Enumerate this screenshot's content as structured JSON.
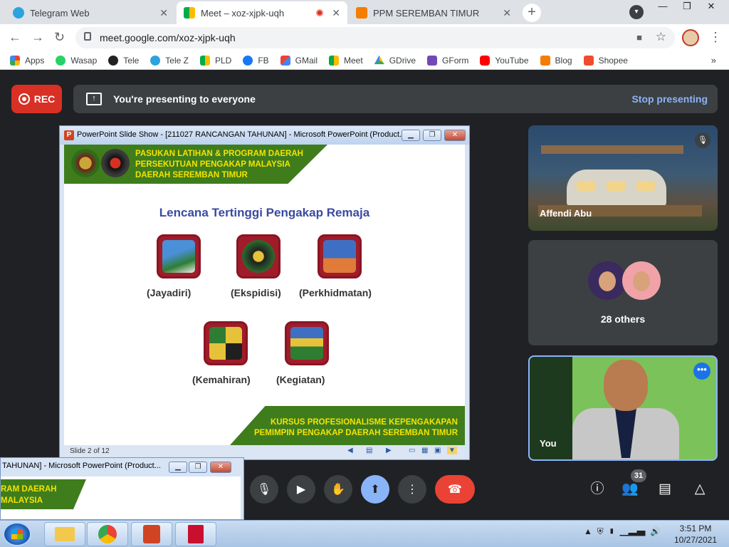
{
  "browser": {
    "tabs": [
      {
        "label": "Telegram Web",
        "active": false
      },
      {
        "label": "Meet – xoz-xjpk-uqh",
        "active": true
      },
      {
        "label": "PPM SEREMBAN TIMUR",
        "active": false
      }
    ],
    "url": "meet.google.com/xoz-xjpk-uqh",
    "bookmarks": [
      "Apps",
      "Wasap",
      "Tele",
      "Tele Z",
      "PLD",
      "FB",
      "GMail",
      "Meet",
      "GDrive",
      "GForm",
      "YouTube",
      "Blog",
      "Shopee"
    ],
    "more_bookmarks": "»"
  },
  "meet": {
    "rec_label": "REC",
    "presenting_text": "You're presenting to everyone",
    "stop_presenting": "Stop presenting",
    "participants": [
      {
        "name": "Affendi Abu",
        "muted": true
      },
      {
        "name": "28 others"
      },
      {
        "name": "You"
      }
    ],
    "participant_count": "31",
    "more_options": "•••"
  },
  "ppt_window": {
    "title": "PowerPoint Slide Show - [211027 RANCANGAN TAHUNAN] - Microsoft PowerPoint (Product...",
    "status": "Slide 2 of 12",
    "slide": {
      "banner_top": [
        "PASUKAN LATIHAN & PROGRAM DAERAH",
        "PERSEKUTUAN PENGAKAP MALAYSIA",
        "DAERAH SEREMBAN TIMUR"
      ],
      "heading": "Lencana Tertinggi Pengakap Remaja",
      "badges": [
        "(Jayadiri)",
        "(Ekspidisi)",
        "(Perkhidmatan)",
        "(Kemahiran)",
        "(Kegiatan)"
      ],
      "banner_bottom": [
        "KURSUS PROFESIONALISME KEPENGAKAPAN",
        "PEMIMPIN PENGAKAP DAERAH SEREMBAN TIMUR"
      ]
    }
  },
  "ppt_window2": {
    "title": "TAHUNAN] - Microsoft PowerPoint (Product...",
    "banner": [
      "RAM DAERAH",
      "MALAYSIA"
    ]
  },
  "taskbar": {
    "time": "3:51 PM",
    "date": "10/27/2021"
  },
  "colors": {
    "meet_bg": "#202124",
    "rec_red": "#d93025",
    "accent_blue": "#8ab4f8",
    "slide_green": "#3f7d1c",
    "slide_yellow": "#f5e300"
  }
}
